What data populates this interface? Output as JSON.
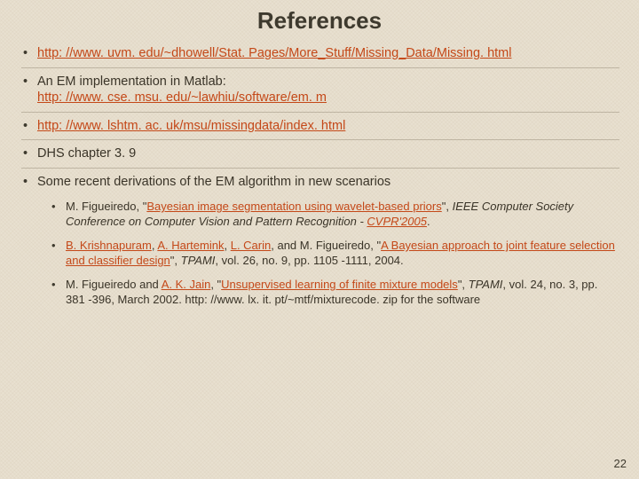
{
  "title": "References",
  "refs": {
    "r1_link": "http: //www. uvm. edu/~dhowell/Stat. Pages/More_Stuff/Missing_Data/Missing. html",
    "r2_pre": "An EM implementation in Matlab: ",
    "r2_link": "http: //www. cse. msu. edu/~lawhiu/software/em. m",
    "r3_link": "http: //www. lshtm. ac. uk/msu/missingdata/index. html",
    "r4": "DHS chapter 3. 9",
    "r5": "Some recent derivations of the EM algorithm in new scenarios"
  },
  "subs": {
    "s1_pre": "M. Figueiredo, \"",
    "s1_link": "Bayesian image segmentation using wavelet-based priors",
    "s1_mid": "\", ",
    "s1_ital": "IEEE Computer Society Conference on Computer Vision and Pattern Recognition - ",
    "s1_conf": "CVPR'2005",
    "s1_end": ".",
    "s2_a1": "B. Krishnapuram",
    "s2_c1": ", ",
    "s2_a2": "A.  Hartemink",
    "s2_c2": ", ",
    "s2_a3": "L. Carin",
    "s2_c3": ", and M. Figueiredo, \"",
    "s2_link": "A Bayesian approach to joint feature selection and classifier design",
    "s2_end": "\", ",
    "s2_ital": "TPAMI",
    "s2_tail": ", vol. 26, no. 9, pp. 1105 -1111, 2004.",
    "s3_pre": "M. Figueiredo and ",
    "s3_a": "A. K. Jain",
    "s3_c": ", \"",
    "s3_link": "Unsupervised learning of finite mixture models",
    "s3_mid": "\", ",
    "s3_ital": "TPAMI",
    "s3_tail": ", vol. 24, no. 3, pp. 381 -396, March 2002. http: //www. lx. it. pt/~mtf/mixturecode. zip for the software"
  },
  "pagenum": "22"
}
